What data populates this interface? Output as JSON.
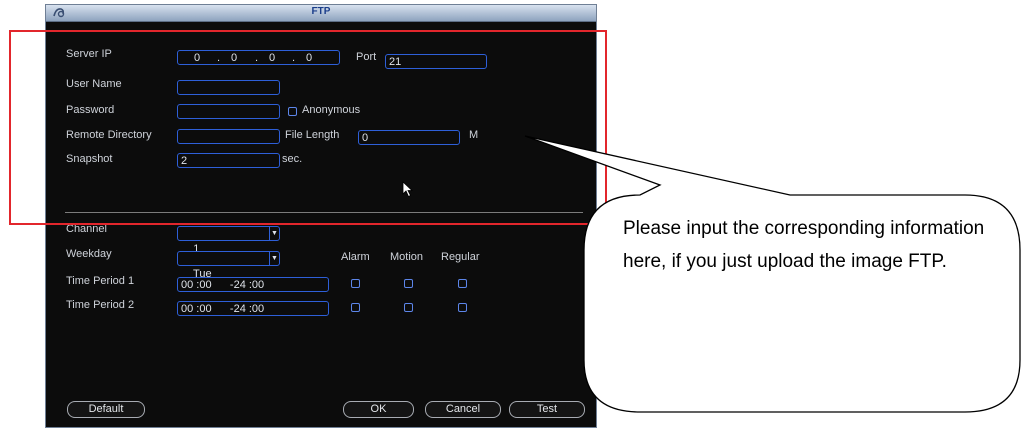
{
  "window": {
    "title": "FTP"
  },
  "form": {
    "server_ip_label": "Server IP",
    "ip": [
      "0",
      "0",
      "0",
      "0"
    ],
    "ip_sep": ".",
    "port_label": "Port",
    "port_value": "21",
    "username_label": "User Name",
    "username_value": "",
    "password_label": "Password",
    "password_value": "",
    "anonymous_label": "Anonymous",
    "remote_dir_label": "Remote Directory",
    "remote_dir_value": "",
    "file_length_label": "File Length",
    "file_length_value": "0",
    "file_length_unit": "M",
    "snapshot_label": "Snapshot",
    "snapshot_value": "2",
    "snapshot_unit": "sec."
  },
  "schedule": {
    "channel_label": "Channel",
    "channel_value": "1",
    "weekday_label": "Weekday",
    "weekday_value": "Tue",
    "col_alarm": "Alarm",
    "col_motion": "Motion",
    "col_regular": "Regular",
    "periods": [
      {
        "label": "Time Period 1",
        "value": "00 :00      -24 :00"
      },
      {
        "label": "Time Period 2",
        "value": "00 :00      -24 :00"
      }
    ]
  },
  "buttons": {
    "default": "Default",
    "ok": "OK",
    "cancel": "Cancel",
    "test": "Test"
  },
  "callout": {
    "text": "Please input the corresponding information here, if you just upload the image FTP."
  },
  "colors": {
    "highlight": "#e2262c",
    "field_border": "#2e5fd8"
  }
}
